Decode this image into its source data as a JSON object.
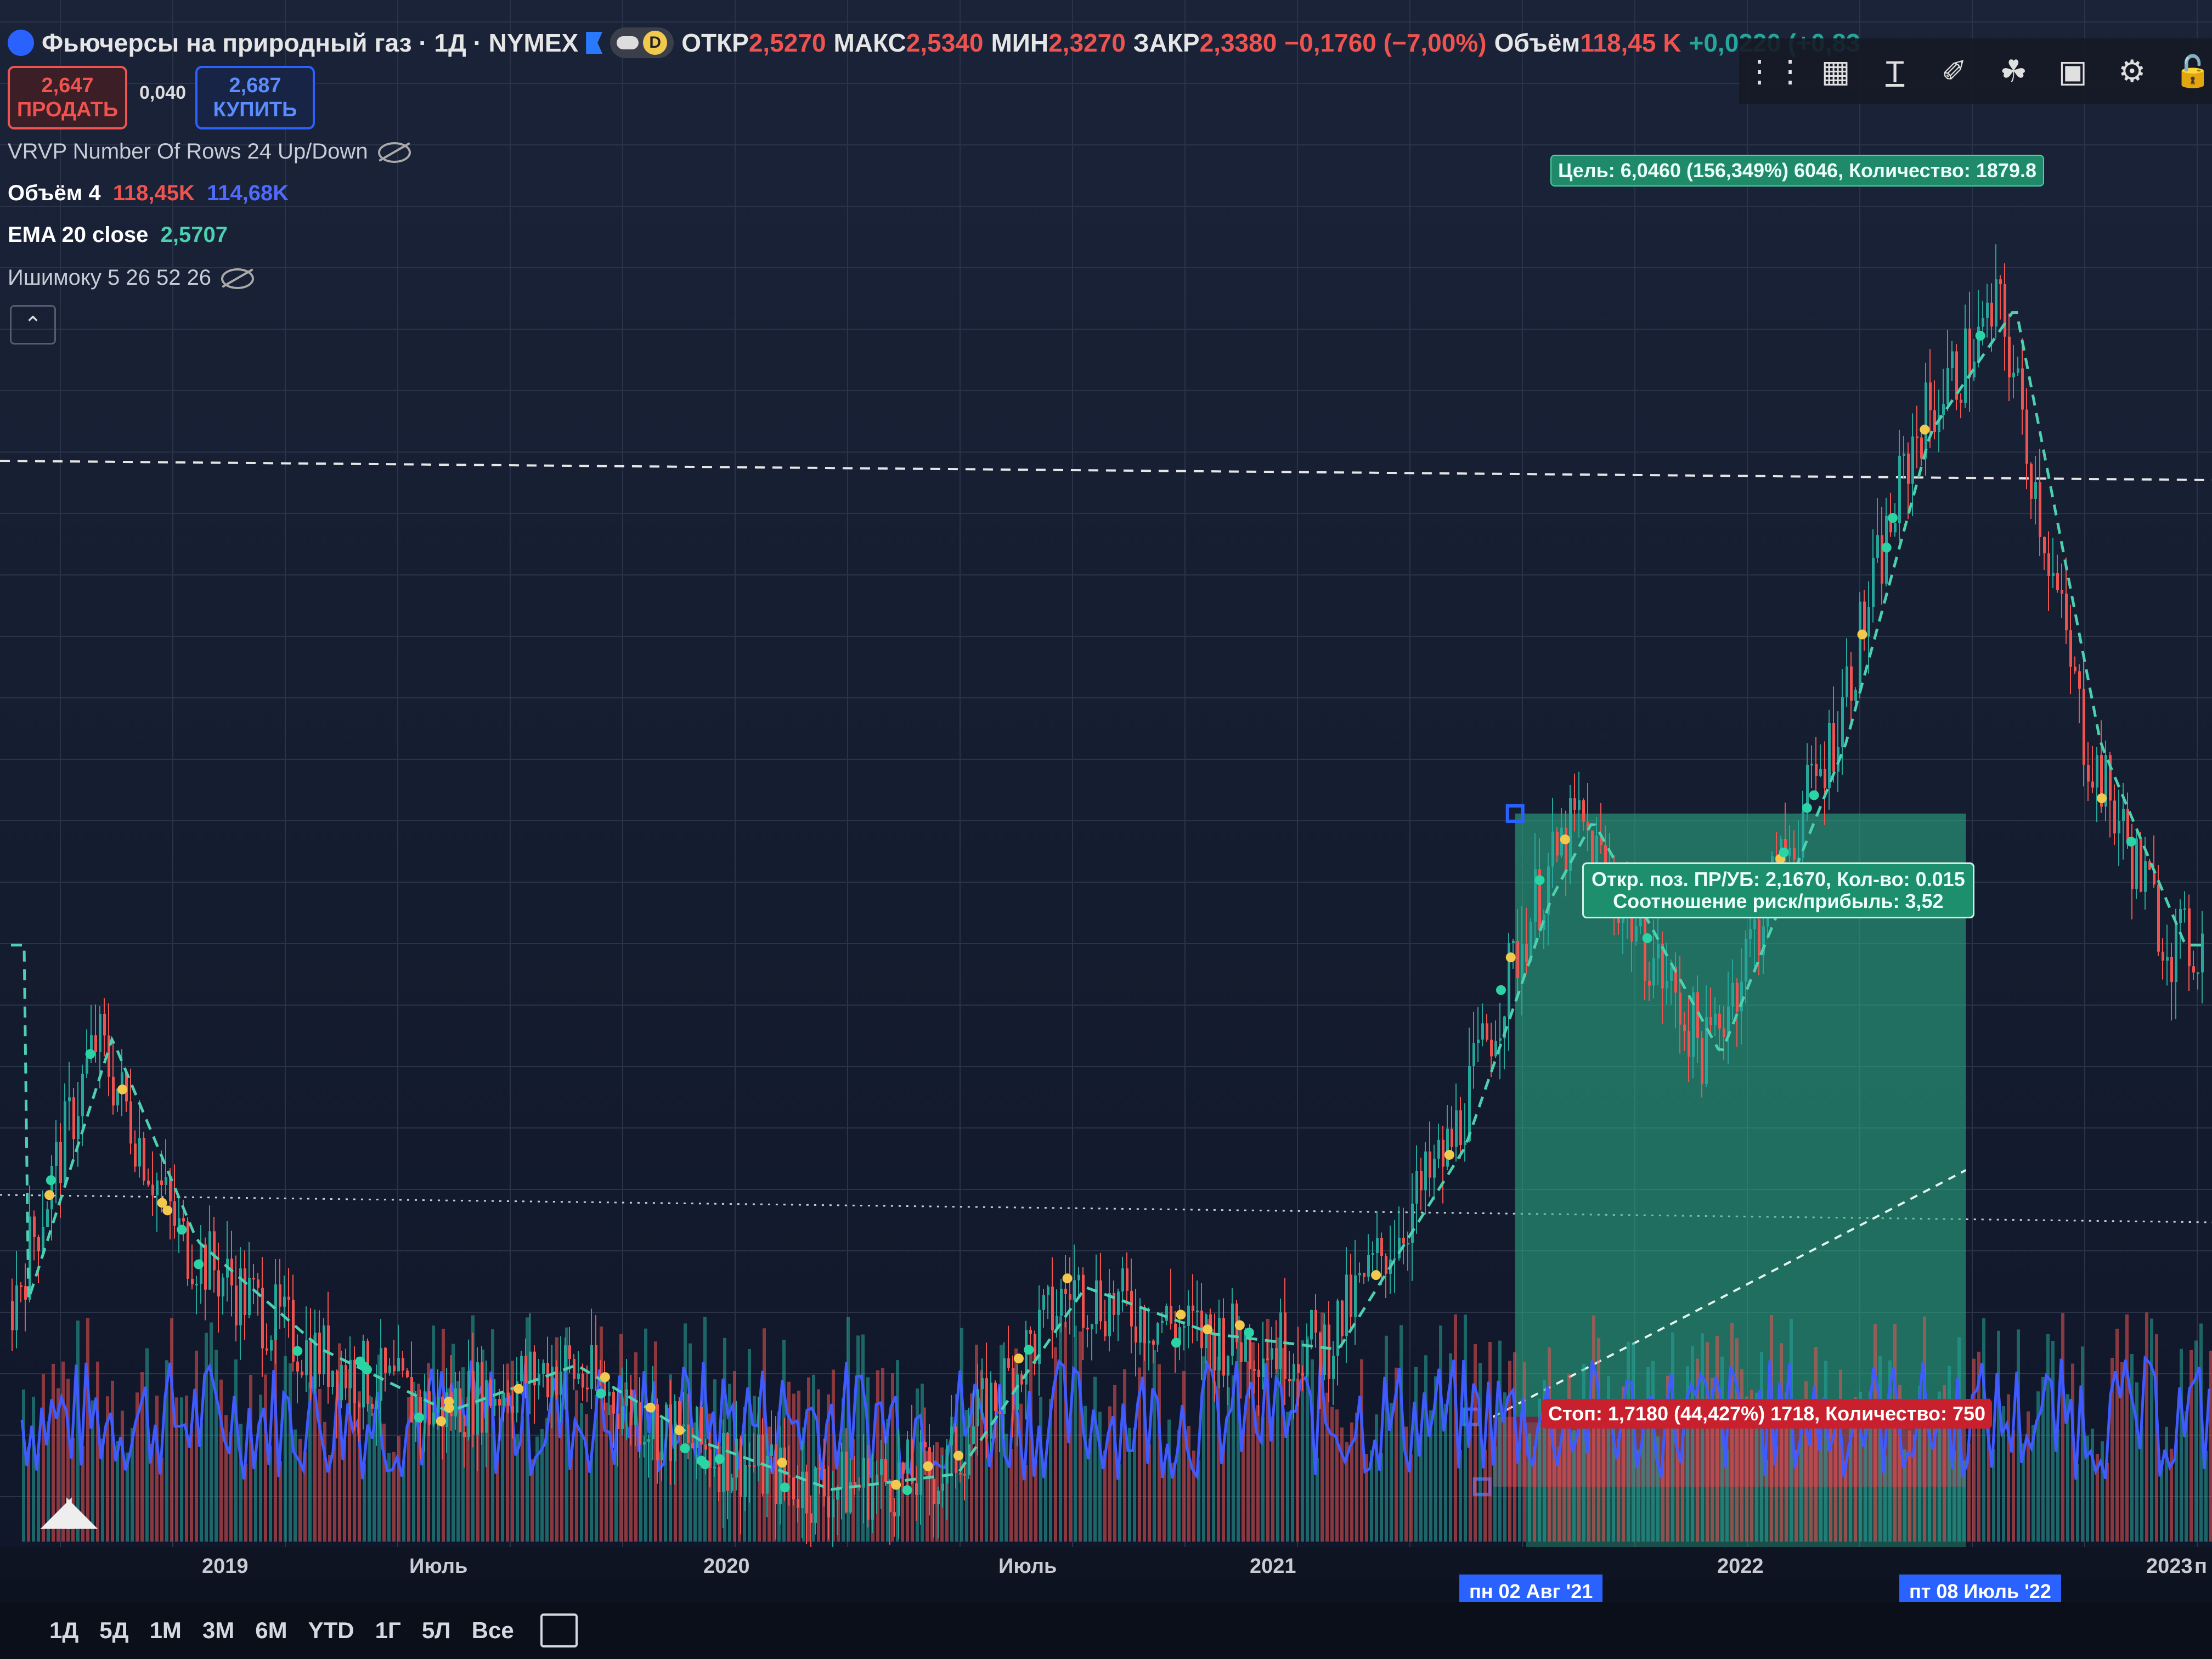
{
  "header": {
    "title": "Фьючерсы на природный газ · 1Д · NYMEX",
    "pill_letter": "D",
    "open_label": "ОТКР",
    "open": "2,5270",
    "high_label": "МАКС",
    "high": "2,5340",
    "low_label": "МИН",
    "low": "2,3270",
    "close_label": "ЗАКР",
    "close": "2,3380",
    "change": "−0,1760 (−7,00%)",
    "volume_label": "Объём",
    "volume": "118,45 K",
    "volume_change": "+0,0220 (+0,83"
  },
  "trade": {
    "sell_price": "2,647",
    "sell_label": "ПРОДАТЬ",
    "spread": "0,040",
    "buy_price": "2,687",
    "buy_label": "КУПИТЬ"
  },
  "indicators": {
    "vrvp": "VRVP Number Of Rows 24 Up/Down",
    "volume_name": "Объём 4",
    "volume_a": "118,45K",
    "volume_b": "114,68K",
    "ema_name": "EMA 20 close",
    "ema_value": "2,5707",
    "ichimoku": "Ишимоку 5 26 52 26"
  },
  "position": {
    "target_label": "Цель: 6,0460 (156,349%) 6046, Количество: 1879.8",
    "stop_label": "Стоп: 1,7180 (44,427%) 1718, Количество: 750",
    "entry_line1": "Откр. поз. ПР/УБ: 2,1670, Кол-во: 0.015",
    "entry_line2": "Соотношение риск/прибыль: 3,52"
  },
  "xaxis": {
    "ticks": [
      "2019",
      "Июль",
      "2020",
      "Июль",
      "2021",
      "2022",
      "2023"
    ],
    "highlight_start": "пн 02 Авг '21",
    "highlight_end": "пт 08 Июль '22",
    "last_tick_partial": "п"
  },
  "ranges": [
    "1Д",
    "5Д",
    "1М",
    "3М",
    "6М",
    "YTD",
    "1Г",
    "5Л",
    "Все"
  ],
  "toolbar_icons": [
    "drag-handle-icon",
    "object-tree-icon",
    "text-icon",
    "fill-icon",
    "bucket-icon",
    "picture-icon",
    "settings-icon",
    "lock-icon"
  ],
  "colors": {
    "up": "#26a69a",
    "down": "#ef5350",
    "volume_line": "#3f5bff",
    "target_zone": "#2bb58a",
    "stop_zone": "#c2334b",
    "ema": "#4dd0b0"
  },
  "chart_data": {
    "type": "candlestick",
    "title": "Фьючерсы на природный газ · 1Д · NYMEX",
    "x_range": [
      "2018-09",
      "2023-01"
    ],
    "y_range": [
      1.4,
      10.0
    ],
    "series": [
      {
        "name": "EMA 20 close",
        "last": 2.5707
      },
      {
        "name": "Объём 4",
        "values": [
          "118,45K",
          "114,68K"
        ]
      }
    ],
    "approx_close": [
      {
        "x": "2018-09",
        "y": 2.9
      },
      {
        "x": "2018-11",
        "y": 4.6
      },
      {
        "x": "2019-01",
        "y": 3.3
      },
      {
        "x": "2019-04",
        "y": 2.6
      },
      {
        "x": "2019-07",
        "y": 2.2
      },
      {
        "x": "2019-10",
        "y": 2.5
      },
      {
        "x": "2020-01",
        "y": 2.0
      },
      {
        "x": "2020-04",
        "y": 1.7
      },
      {
        "x": "2020-07",
        "y": 1.8
      },
      {
        "x": "2020-10",
        "y": 3.0
      },
      {
        "x": "2021-01",
        "y": 2.7
      },
      {
        "x": "2021-04",
        "y": 2.6
      },
      {
        "x": "2021-07",
        "y": 3.9
      },
      {
        "x": "2021-09",
        "y": 5.5
      },
      {
        "x": "2021-10",
        "y": 6.0
      },
      {
        "x": "2022-01",
        "y": 4.5
      },
      {
        "x": "2022-04",
        "y": 6.5
      },
      {
        "x": "2022-06",
        "y": 8.5
      },
      {
        "x": "2022-08",
        "y": 9.3
      },
      {
        "x": "2022-10",
        "y": 6.5
      },
      {
        "x": "2022-12",
        "y": 5.2
      }
    ],
    "position_tool": {
      "entry": 2.167,
      "target": 6.046,
      "stop": 1.718,
      "risk_reward": 3.52
    }
  }
}
